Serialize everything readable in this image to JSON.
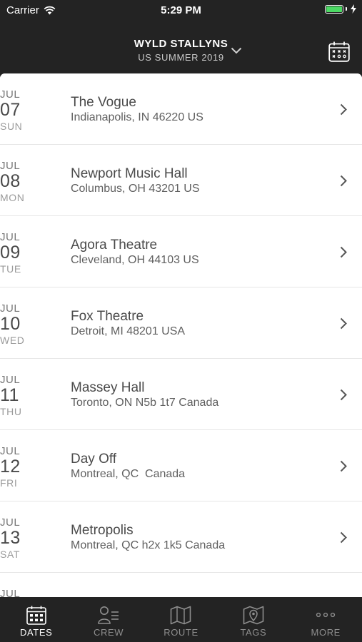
{
  "status_bar": {
    "carrier": "Carrier",
    "time": "5:29 PM",
    "battery_level": 1.0,
    "battery_color": "#4cd964"
  },
  "header": {
    "title": "WYLD STALLYNS",
    "subtitle": "US SUMMER 2019"
  },
  "dates": [
    {
      "month": "JUL",
      "day": "07",
      "dow": "SUN",
      "venue": "The Vogue",
      "address": "Indianapolis, IN 46220 US"
    },
    {
      "month": "JUL",
      "day": "08",
      "dow": "MON",
      "venue": "Newport Music Hall",
      "address": "Columbus, OH 43201 US"
    },
    {
      "month": "JUL",
      "day": "09",
      "dow": "TUE",
      "venue": "Agora Theatre",
      "address": "Cleveland, OH 44103 US"
    },
    {
      "month": "JUL",
      "day": "10",
      "dow": "WED",
      "venue": "Fox Theatre",
      "address": "Detroit, MI 48201 USA"
    },
    {
      "month": "JUL",
      "day": "11",
      "dow": "THU",
      "venue": "Massey Hall",
      "address": "Toronto, ON N5b 1t7 Canada"
    },
    {
      "month": "JUL",
      "day": "12",
      "dow": "FRI",
      "venue": "Day Off",
      "address": "Montreal, QC  Canada"
    },
    {
      "month": "JUL",
      "day": "13",
      "dow": "SAT",
      "venue": "Metropolis",
      "address": "Montreal, QC h2x 1k5 Canada"
    },
    {
      "month": "JUL",
      "day": "",
      "dow": "",
      "venue": "",
      "address": ""
    }
  ],
  "tabs": [
    {
      "label": "DATES",
      "icon": "calendar-icon",
      "active": true
    },
    {
      "label": "CREW",
      "icon": "crew-icon",
      "active": false
    },
    {
      "label": "ROUTE",
      "icon": "map-icon",
      "active": false
    },
    {
      "label": "TAGS",
      "icon": "map-pin-icon",
      "active": false
    },
    {
      "label": "MORE",
      "icon": "more-icon",
      "active": false
    }
  ]
}
